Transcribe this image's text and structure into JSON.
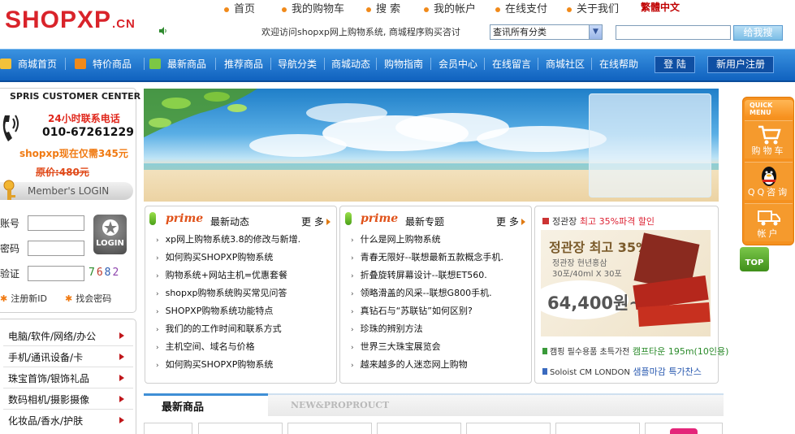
{
  "header": {
    "logo_main": "SHOPXP",
    "logo_tld": ".CN",
    "top_links": [
      "首页",
      "我的购物车",
      "搜 索",
      "我的帐户",
      "在线支付",
      "关于我们"
    ],
    "lang_link": "繁體中文",
    "welcome_text": "欢迎访问shopxp网上购物系统, 商城程序购买咨讨",
    "category_select_value": "查讯所有分类",
    "search_button_label": "给我搜"
  },
  "nav": {
    "items": [
      "商城首页",
      "特价商品",
      "最新商品",
      "推荐商品",
      "导航分类",
      "商城动态",
      "购物指南",
      "会员中心",
      "在线留言",
      "商城社区",
      "在线帮助"
    ],
    "login_label": "登 陆",
    "register_label": "新用户注册"
  },
  "sidebar": {
    "customer_center_title": "SPRIS CUSTOMER CENTER",
    "hotline_label": "24小时联系电话",
    "hotline_number": "010-67261229",
    "promo_text": "shopxp现在仅需345元",
    "original_price": "原价:480元",
    "member_login_label": "Member's LOGIN",
    "account_label": "账号",
    "password_label": "密码",
    "captcha_label": "验证",
    "captcha_code": "7682",
    "login_submit_label": "LOGIN",
    "register_link": "注册新ID",
    "forgot_link": "找会密码",
    "categories": [
      "电脑/软件/网络/办公",
      "手机/通讯设备/卡",
      "珠宝首饰/银饰礼品",
      "数码相机/摄影摄像",
      "化妆品/香水/护肤"
    ]
  },
  "news_box_1": {
    "prime": "prime",
    "title": "最新动态",
    "more": "更 多",
    "items": [
      "xp网上购物系统3.8的修改与新增.",
      "如何购买SHOPXP购物系统",
      "购物系统+网站主机=优惠套餐",
      "shopxp购物系统购买常见问答",
      "SHOPXP购物系统功能特点",
      "我们的的工作时间和联系方式",
      "主机空间、域名与价格",
      "如何购买SHOPXP购物系统"
    ]
  },
  "news_box_2": {
    "prime": "prime",
    "title": "最新专题",
    "more": "更 多",
    "items": [
      "什么是网上购物系统",
      "青春无限好--联想最新五款概念手机.",
      "折叠旋转屏幕设计--联想ET560.",
      "领略滑盖的风采--联想G800手机.",
      "真钻石与“苏联钻”如何区别?",
      "珍珠的辨别方法",
      "世界三大珠宝展览会",
      "越来越多的人迷恋网上购物"
    ]
  },
  "ad_box": {
    "top_line_brand": "정관장",
    "top_line_text": "최고 35%파격 할인",
    "image_headline": "정관장 최고 35%할인",
    "image_subline_1": "정관장 현년홍삼",
    "image_subline_2": "30포/40ml X 30포",
    "image_price": "64,400원~",
    "line_2_a": "캠핑 필수용품 초특가전",
    "line_2_b": "캠프타운 195m(10인용)",
    "line_3_a": "Soloist CM LONDON",
    "line_3_b": "샘플마감 특가찬스"
  },
  "new_products": {
    "title": "最新商品",
    "subtitle": "NEW&PROPROUCT"
  },
  "quick_menu": {
    "header": "QUICK MENU",
    "items": [
      "购物车",
      "QQ咨询",
      "帐户"
    ],
    "top_label": "TOP"
  },
  "colors": {
    "logo_red": "#d9232a",
    "nav_blue": "#1a6fc9",
    "accent_orange": "#f5911f",
    "prime_orange": "#e0521a"
  }
}
